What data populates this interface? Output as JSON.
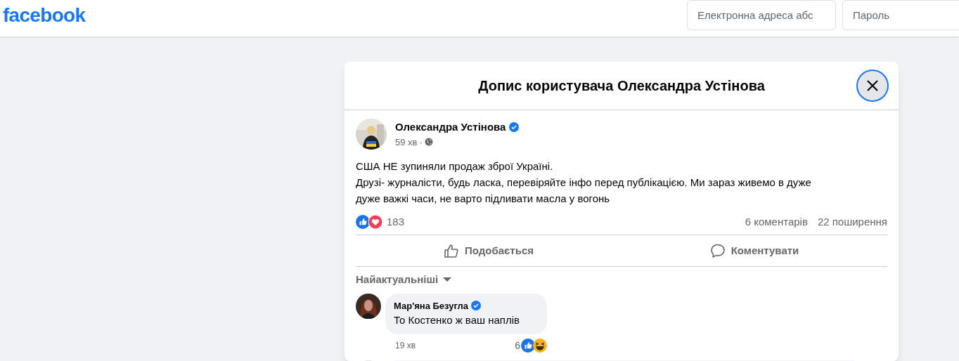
{
  "header": {
    "logo": "facebook",
    "email_field": {
      "placeholder": "Електронна адреса абс"
    },
    "password_field": {
      "placeholder": "Пароль"
    }
  },
  "dialog": {
    "title": "Допис користувача Олександра Устінова"
  },
  "post": {
    "author": "Олександра Устінова",
    "verified": true,
    "time": "59 хв",
    "time_separator": "·",
    "paragraphs": [
      "США НЕ зупиняли продаж зброї Україні.",
      "Друзі- журналісти, будь ласка, перевіряйте інфо перед публікацією. Ми зараз живемо в дуже дуже важкі часи, не варто підливати масла у вогонь"
    ],
    "reactions_count": "183",
    "comments_count": "6 коментарів",
    "shares_count": "22 поширення",
    "actions": [
      {
        "kind": "like",
        "label": "Подобається"
      },
      {
        "kind": "comment",
        "label": "Коментувати"
      }
    ]
  },
  "comment_sort": "Найактуальніші",
  "comments": [
    {
      "author": "Мар'яна Безугла",
      "verified": true,
      "text": "То Костенко ж ваш наплів",
      "time": "19 хв",
      "reactions_count": "6"
    }
  ]
}
